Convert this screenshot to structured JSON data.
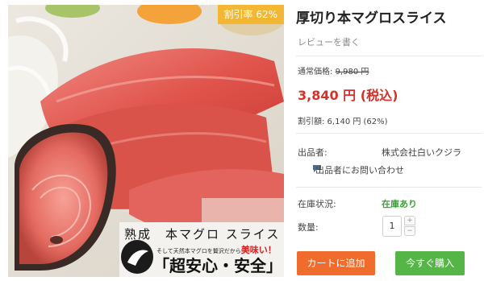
{
  "image": {
    "badge": "割引率 62%",
    "banner_top": "熟成　本マグロ スライス",
    "banner_sub": "そして天然本マグロを贅沢だから",
    "banner_sub_red": "美味い！",
    "banner_main": "「超安心・安全」"
  },
  "product": {
    "title": "厚切り本マグロスライス",
    "review_link": "レビューを書く",
    "regular_price_label": "通常価格: ",
    "regular_price": "9,980 円",
    "price": "3,840 円 (税込)",
    "discount_text": "割引額: 6,140 円 (62%)",
    "seller_label": "出品者:",
    "seller_name": "株式会社白いクジラ",
    "contact_link": "出品者にお問い合わせ",
    "stock_label": "在庫状況:",
    "stock_status": "在庫あり",
    "qty_label": "数量:",
    "qty_value": "1"
  },
  "buttons": {
    "add_to_cart": "カートに追加",
    "buy_now": "今すぐ購入"
  },
  "colors": {
    "price": "#d7302a",
    "badge": "#f3b733",
    "cart_button": "#ef6c2c",
    "buy_button": "#55b546",
    "stock": "#3aa335"
  },
  "icons": [
    "chat-bubble-icon",
    "chevron-up-icon",
    "chevron-down-icon"
  ]
}
